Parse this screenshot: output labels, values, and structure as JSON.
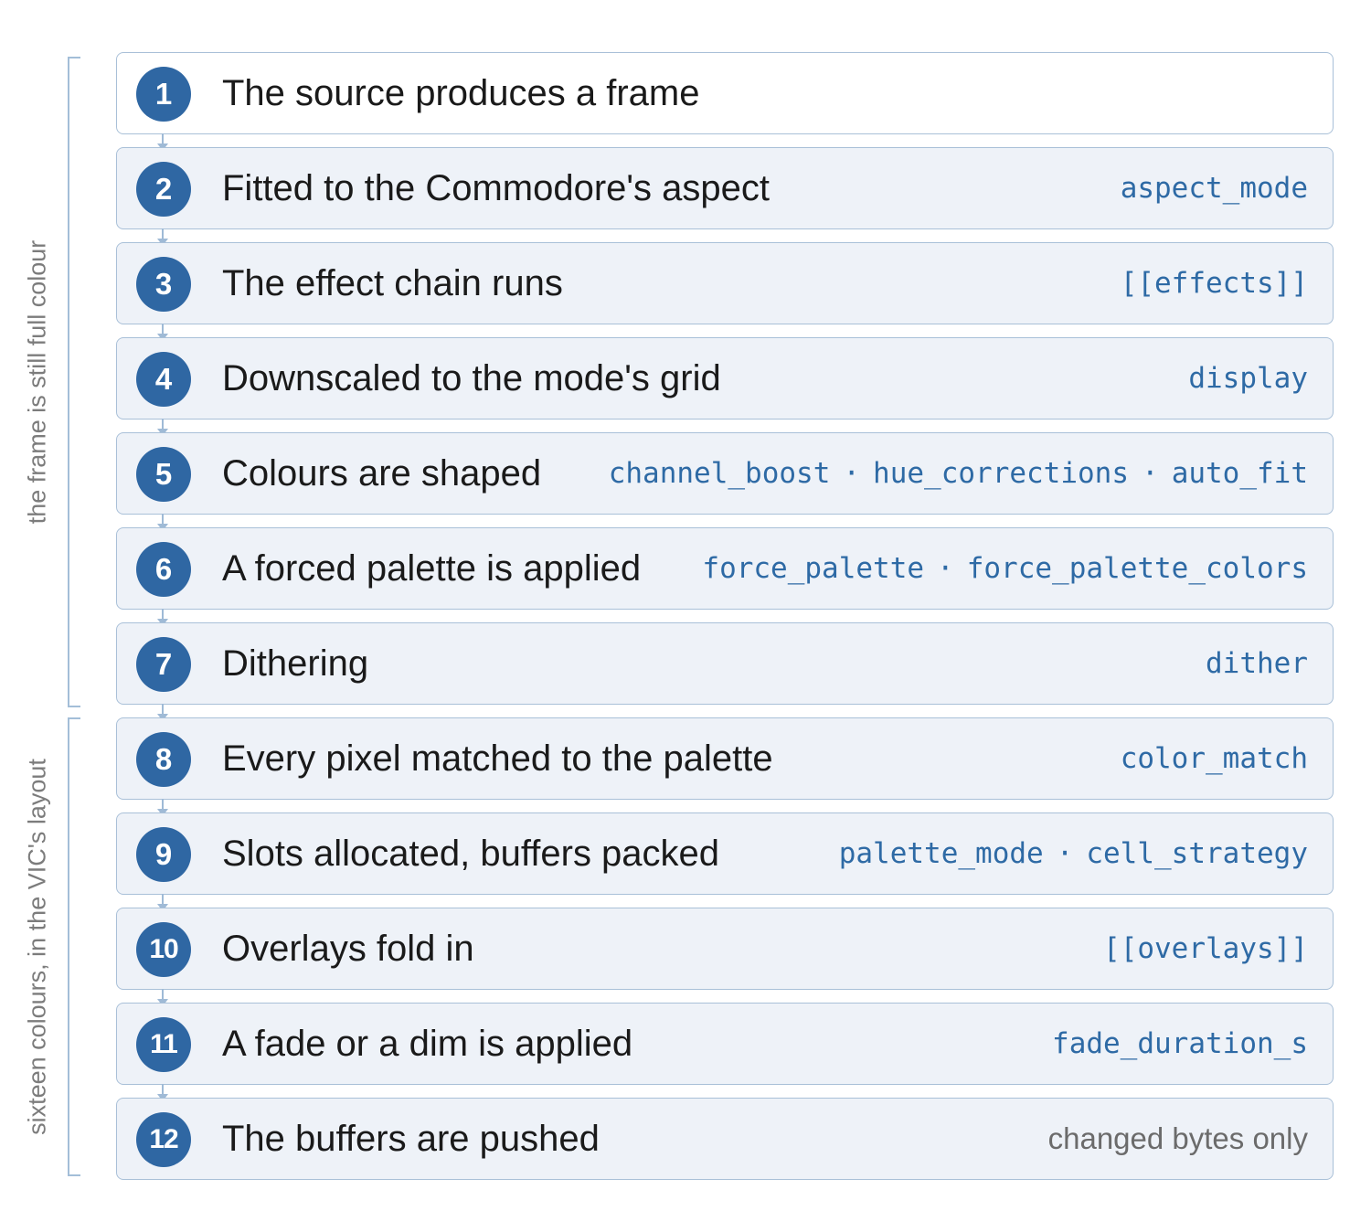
{
  "phases": {
    "upper_label": "the frame is still full colour",
    "lower_label": "sixteen colours, in the VIC's layout"
  },
  "steps": [
    {
      "number": "1",
      "title": "The source produces a frame",
      "params": []
    },
    {
      "number": "2",
      "title": "Fitted to the Commodore's aspect",
      "params": [
        "aspect_mode"
      ]
    },
    {
      "number": "3",
      "title": "The effect chain runs",
      "params": [
        "[[effects]]"
      ]
    },
    {
      "number": "4",
      "title": "Downscaled to the mode's grid",
      "params": [
        "display"
      ]
    },
    {
      "number": "5",
      "title": "Colours are shaped",
      "params": [
        "channel_boost",
        "hue_corrections",
        "auto_fit"
      ]
    },
    {
      "number": "6",
      "title": "A forced palette is applied",
      "params": [
        "force_palette",
        "force_palette_colors"
      ]
    },
    {
      "number": "7",
      "title": "Dithering",
      "params": [
        "dither"
      ]
    },
    {
      "number": "8",
      "title": "Every pixel matched to the palette",
      "params": [
        "color_match"
      ]
    },
    {
      "number": "9",
      "title": "Slots allocated, buffers packed",
      "params": [
        "palette_mode",
        "cell_strategy"
      ]
    },
    {
      "number": "10",
      "title": "Overlays fold in",
      "params": [
        "[[overlays]]"
      ]
    },
    {
      "number": "11",
      "title": "A fade or a dim is applied",
      "params": [
        "fade_duration_s"
      ]
    },
    {
      "number": "12",
      "title": "The buffers are pushed",
      "note": "changed bytes only"
    }
  ],
  "separator": "·",
  "colors": {
    "badge": "#2f67a3",
    "param_text": "#2e6aa5",
    "box_fill": "#eef2f8",
    "box_border": "#a9c0d8",
    "bracket": "#a3bed8"
  }
}
